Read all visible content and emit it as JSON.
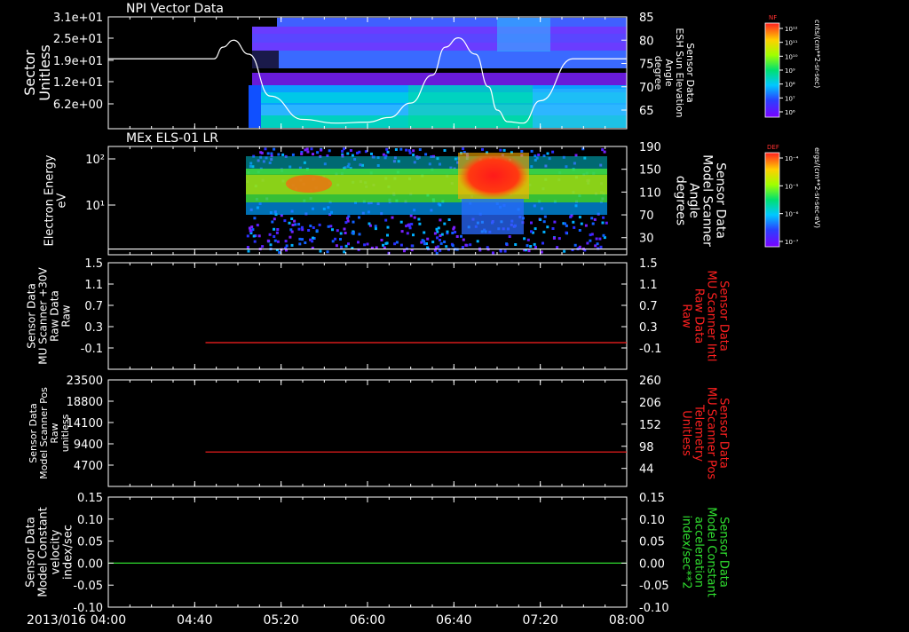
{
  "date_label": "2013/016",
  "time_ticks": [
    "04:00",
    "04:40",
    "05:20",
    "06:00",
    "06:40",
    "07:20",
    "08:00"
  ],
  "colors": {
    "background": "#000000",
    "frame": "#ffffff",
    "red_line": "#ff2020",
    "green_line": "#30e030"
  },
  "colorbars": [
    {
      "id": "nf",
      "title": "NF",
      "unit": "cnts/(cm**2-sr-sec)",
      "ticks": [
        "10¹²",
        "10¹¹",
        "10¹⁰",
        "10⁹",
        "10⁸",
        "10⁷",
        "10⁶"
      ]
    },
    {
      "id": "def",
      "title": "DEF",
      "unit": "ergs/(cm**2-sr-sec-eV)",
      "ticks": [
        "10⁻⁴",
        "10⁻⁵",
        "10⁻⁶",
        "10⁻⁷"
      ]
    }
  ],
  "chart_data": [
    {
      "type": "heatmap",
      "title": "NPI Vector Data",
      "ylabel": [
        "Sector",
        "Unitless"
      ],
      "y_ticks": [
        "3.1e+01",
        "2.5e+01",
        "1.9e+01",
        "1.2e+01",
        "6.2e+00"
      ],
      "y2label": [
        "Sensor Data",
        "ESH Sun Elevation",
        "Angle",
        "degree"
      ],
      "y2_ticks": [
        85,
        80,
        75,
        70,
        65
      ],
      "y2lim": [
        61,
        85
      ],
      "overlay_line": {
        "name": "ESH Sun Elevation Angle",
        "x": [
          "04:00",
          "04:49",
          "04:53",
          "04:58",
          "05:05",
          "05:15",
          "05:30",
          "05:45",
          "06:00",
          "06:10",
          "06:20",
          "06:30",
          "06:36",
          "06:42",
          "06:50",
          "06:56",
          "07:00",
          "07:05",
          "07:12",
          "07:20",
          "07:35",
          "07:50",
          "08:00"
        ],
        "y": [
          76,
          76,
          78.5,
          80,
          77,
          68,
          63,
          62.2,
          62.4,
          63.4,
          66.5,
          72.5,
          78.5,
          80.5,
          77,
          70,
          65,
          62.5,
          62.2,
          67,
          76,
          76,
          76
        ]
      }
    },
    {
      "type": "heatmap",
      "title": "MEx ELS-01 LR",
      "ylabel": [
        "Electron Energy",
        "eV"
      ],
      "y_ticks": [
        "10²",
        "10¹"
      ],
      "y2label": [
        "Sensor Data",
        "Model Scanner",
        "Angle",
        "degrees"
      ],
      "y2_ticks": [
        190,
        150,
        110,
        70,
        30
      ],
      "y2lim": [
        0,
        190
      ],
      "overlay_line": {
        "name": "Model Scanner Angle",
        "x": [
          "04:00",
          "08:00"
        ],
        "y": [
          10,
          10
        ]
      }
    },
    {
      "type": "line",
      "ylabel": [
        "Sensor Data",
        "MU Scanner +30V",
        "Raw Data",
        "Raw"
      ],
      "y_ticks": [
        "1.5",
        "1.1",
        "0.7",
        "0.3",
        "-0.1"
      ],
      "ylim": [
        -0.5,
        1.5
      ],
      "y2label": [
        "Sensor Data",
        "MU Scanner Intl",
        "Raw Data",
        "Raw"
      ],
      "y2_ticks": [
        "1.5",
        "1.1",
        "0.7",
        "0.3",
        "-0.1"
      ],
      "y2lim": [
        -0.5,
        1.5
      ],
      "series": [
        {
          "x": [
            "04:45",
            "08:00"
          ],
          "y": [
            0.0,
            0.0
          ],
          "color": "#ff2020"
        }
      ]
    },
    {
      "type": "line",
      "ylabel": [
        "Sensor Data",
        "Model Scanner Pos",
        "Raw",
        "unitless"
      ],
      "y_ticks": [
        "23500",
        "18800",
        "14100",
        "9400",
        "4700"
      ],
      "ylim": [
        0,
        23500
      ],
      "y2label": [
        "Sensor Data",
        "MU Scanner Pos",
        "Telemetry",
        "Unitless"
      ],
      "y2_ticks": [
        260,
        206,
        152,
        98,
        44
      ],
      "y2lim": [
        0,
        260
      ],
      "series": [
        {
          "x": [
            "04:45",
            "08:00"
          ],
          "y": [
            7600,
            7600
          ],
          "color": "#ff2020"
        }
      ]
    },
    {
      "type": "line",
      "ylabel": [
        "Sensor Data",
        "Model Constant",
        "velocity",
        "index/sec"
      ],
      "y_ticks": [
        "0.15",
        "0.10",
        "0.05",
        "0.00",
        "-0.05",
        "-0.10"
      ],
      "ylim": [
        -0.1,
        0.15
      ],
      "y2label": [
        "Sensor Data",
        "Model Constant",
        "acceleration",
        "index/sec**2"
      ],
      "y2_ticks": [
        "0.15",
        "0.10",
        "0.05",
        "0.00",
        "-0.05",
        "-0.10"
      ],
      "y2lim": [
        -0.1,
        0.15
      ],
      "series": [
        {
          "x": [
            "04:00",
            "08:00"
          ],
          "y": [
            0.0,
            0.0
          ],
          "color": "#30e030"
        }
      ]
    }
  ]
}
